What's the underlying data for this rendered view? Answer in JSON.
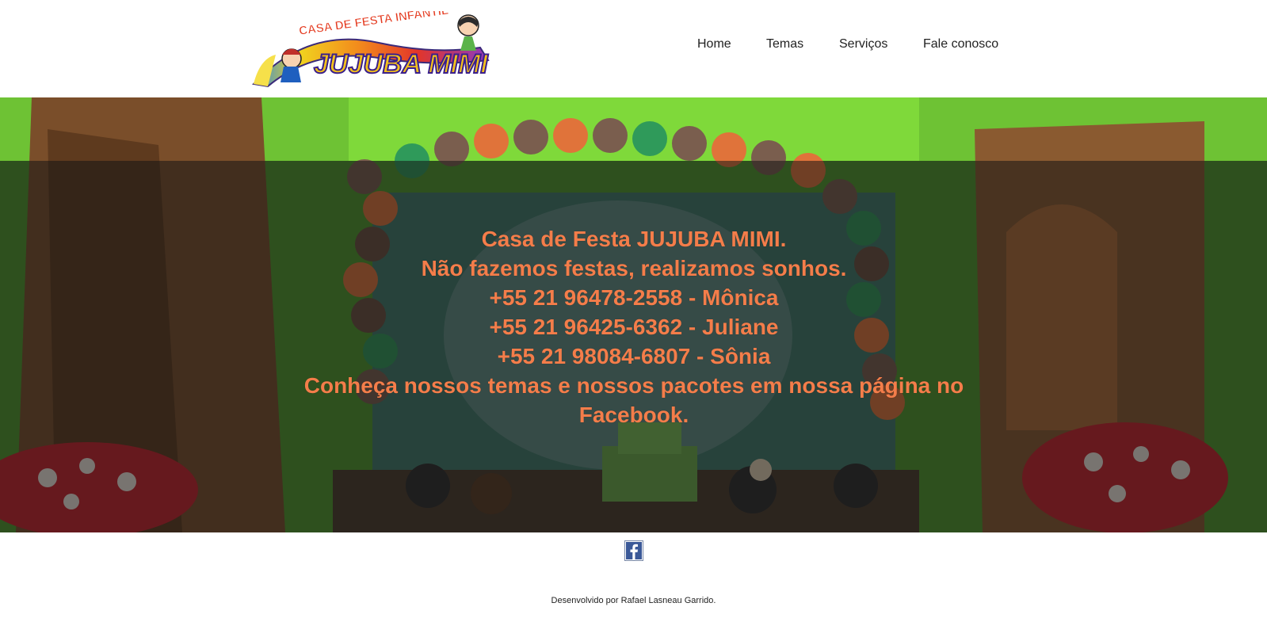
{
  "logo": {
    "line1": "CASA DE FESTA INFANTIL",
    "line2": "JUJUBA MIMI"
  },
  "nav": {
    "items": [
      {
        "label": "Home"
      },
      {
        "label": "Temas"
      },
      {
        "label": "Serviços"
      },
      {
        "label": "Fale conosco"
      }
    ]
  },
  "hero": {
    "lines": [
      "Casa de Festa JUJUBA MIMI.",
      "Não fazemos festas, realizamos sonhos.",
      "+55 21 96478-2558 - Mônica",
      "+55 21 96425-6362 - Juliane",
      "+55 21 98084-6807 - Sônia",
      "Conheça nossos temas e nossos pacotes em nossa página no",
      "Facebook."
    ],
    "text_color": "#f47d4a"
  },
  "footer": {
    "facebook_icon": "facebook-icon",
    "credit": "Desenvolvido por Rafael Lasneau Garrido."
  },
  "colors": {
    "hero_green": "#5fb52b",
    "overlay": "#141414",
    "facebook_blue": "#3b5998"
  }
}
